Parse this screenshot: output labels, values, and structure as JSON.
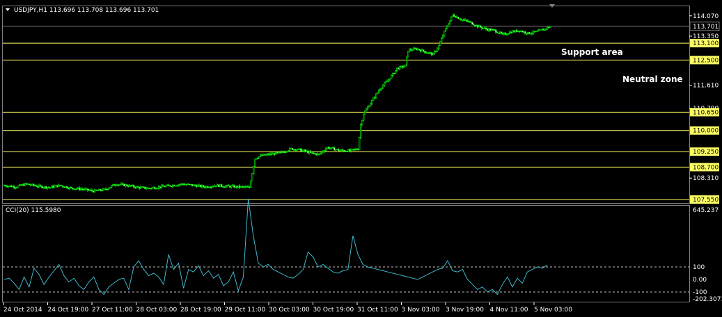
{
  "chart_data": [
    {
      "type": "candlestick",
      "symbol_line": "USDJPY,H1  113.696 113.708 113.696 113.701",
      "price_axis_labels": [
        "114.070",
        "113.701",
        "113.350",
        "113.100",
        "112.500",
        "111.610",
        "110.790",
        "110.650",
        "110.000",
        "109.250",
        "108.700",
        "108.310",
        "107.550"
      ],
      "current_price": "113.701",
      "horizontal_levels": [
        "113.100",
        "112.500",
        "110.650",
        "110.000",
        "109.250",
        "108.700",
        "107.550"
      ],
      "annotations": [
        "Support area",
        "Neutral zone"
      ],
      "x_tick_labels": [
        "24 Oct 2014",
        "24 Oct 19:00",
        "27 Oct 11:00",
        "28 Oct 03:00",
        "28 Oct 19:00",
        "29 Oct 11:00",
        "30 Oct 03:00",
        "30 Oct 19:00",
        "31 Oct 11:00",
        "3 Nov 03:00",
        "3 Nov 19:00",
        "4 Nov 11:00",
        "5 Nov 03:00"
      ],
      "price_path": [
        [
          0,
          108.05
        ],
        [
          8,
          108.0
        ],
        [
          16,
          108.1
        ],
        [
          24,
          108.02
        ],
        [
          32,
          107.98
        ],
        [
          40,
          108.05
        ],
        [
          48,
          107.95
        ],
        [
          56,
          107.92
        ],
        [
          64,
          107.85
        ],
        [
          72,
          107.9
        ],
        [
          80,
          108.1
        ],
        [
          88,
          108.05
        ],
        [
          96,
          107.98
        ],
        [
          104,
          107.95
        ],
        [
          112,
          108.0
        ],
        [
          120,
          108.05
        ],
        [
          128,
          108.1
        ],
        [
          136,
          108.05
        ],
        [
          144,
          108.0
        ],
        [
          152,
          108.05
        ],
        [
          160,
          108.02
        ],
        [
          168,
          108.0
        ],
        [
          176,
          107.98
        ],
        [
          180,
          109.0
        ],
        [
          184,
          109.1
        ],
        [
          190,
          109.15
        ],
        [
          198,
          109.2
        ],
        [
          206,
          109.35
        ],
        [
          214,
          109.3
        ],
        [
          220,
          109.2
        ],
        [
          226,
          109.15
        ],
        [
          232,
          109.4
        ],
        [
          240,
          109.3
        ],
        [
          248,
          109.28
        ],
        [
          254,
          109.35
        ],
        [
          256,
          110.2
        ],
        [
          258,
          110.6
        ],
        [
          262,
          110.9
        ],
        [
          266,
          111.2
        ],
        [
          270,
          111.5
        ],
        [
          276,
          111.8
        ],
        [
          282,
          112.2
        ],
        [
          288,
          112.3
        ],
        [
          290,
          112.85
        ],
        [
          296,
          112.9
        ],
        [
          302,
          112.8
        ],
        [
          308,
          112.7
        ],
        [
          312,
          113.0
        ],
        [
          316,
          113.5
        ],
        [
          320,
          113.9
        ],
        [
          322,
          114.1
        ],
        [
          328,
          113.95
        ],
        [
          334,
          113.85
        ],
        [
          340,
          113.7
        ],
        [
          346,
          113.6
        ],
        [
          352,
          113.55
        ],
        [
          358,
          113.4
        ],
        [
          364,
          113.5
        ],
        [
          370,
          113.55
        ],
        [
          376,
          113.45
        ],
        [
          382,
          113.5
        ],
        [
          388,
          113.6
        ],
        [
          392,
          113.7
        ]
      ]
    },
    {
      "type": "line",
      "indicator_title": "CCI(20) 115.5980",
      "axis_labels": [
        "645.237",
        "100",
        "0.00",
        "-100",
        "-202.3071"
      ],
      "dashed_levels": [
        100,
        -100
      ],
      "values": [
        0,
        10,
        -30,
        -80,
        20,
        -60,
        90,
        40,
        -40,
        20,
        70,
        120,
        30,
        -20,
        10,
        -50,
        -80,
        -20,
        20,
        -80,
        -120,
        -60,
        -30,
        0,
        10,
        -80,
        100,
        150,
        80,
        30,
        50,
        20,
        -40,
        200,
        80,
        130,
        -70,
        80,
        60,
        110,
        30,
        70,
        10,
        40,
        -50,
        -20,
        60,
        -90,
        20,
        645,
        350,
        130,
        100,
        120,
        80,
        60,
        40,
        20,
        10,
        40,
        80,
        220,
        180,
        100,
        120,
        90,
        60,
        50,
        70,
        80,
        350,
        200,
        120,
        100,
        90,
        80,
        70,
        60,
        50,
        40,
        30,
        20,
        10,
        0,
        20,
        40,
        60,
        80,
        90,
        150,
        70,
        60,
        80,
        0,
        -40,
        -80,
        -60,
        -100,
        -80,
        -120,
        -40,
        20,
        -60,
        10,
        -30,
        60,
        80,
        100,
        90,
        115
      ]
    }
  ]
}
